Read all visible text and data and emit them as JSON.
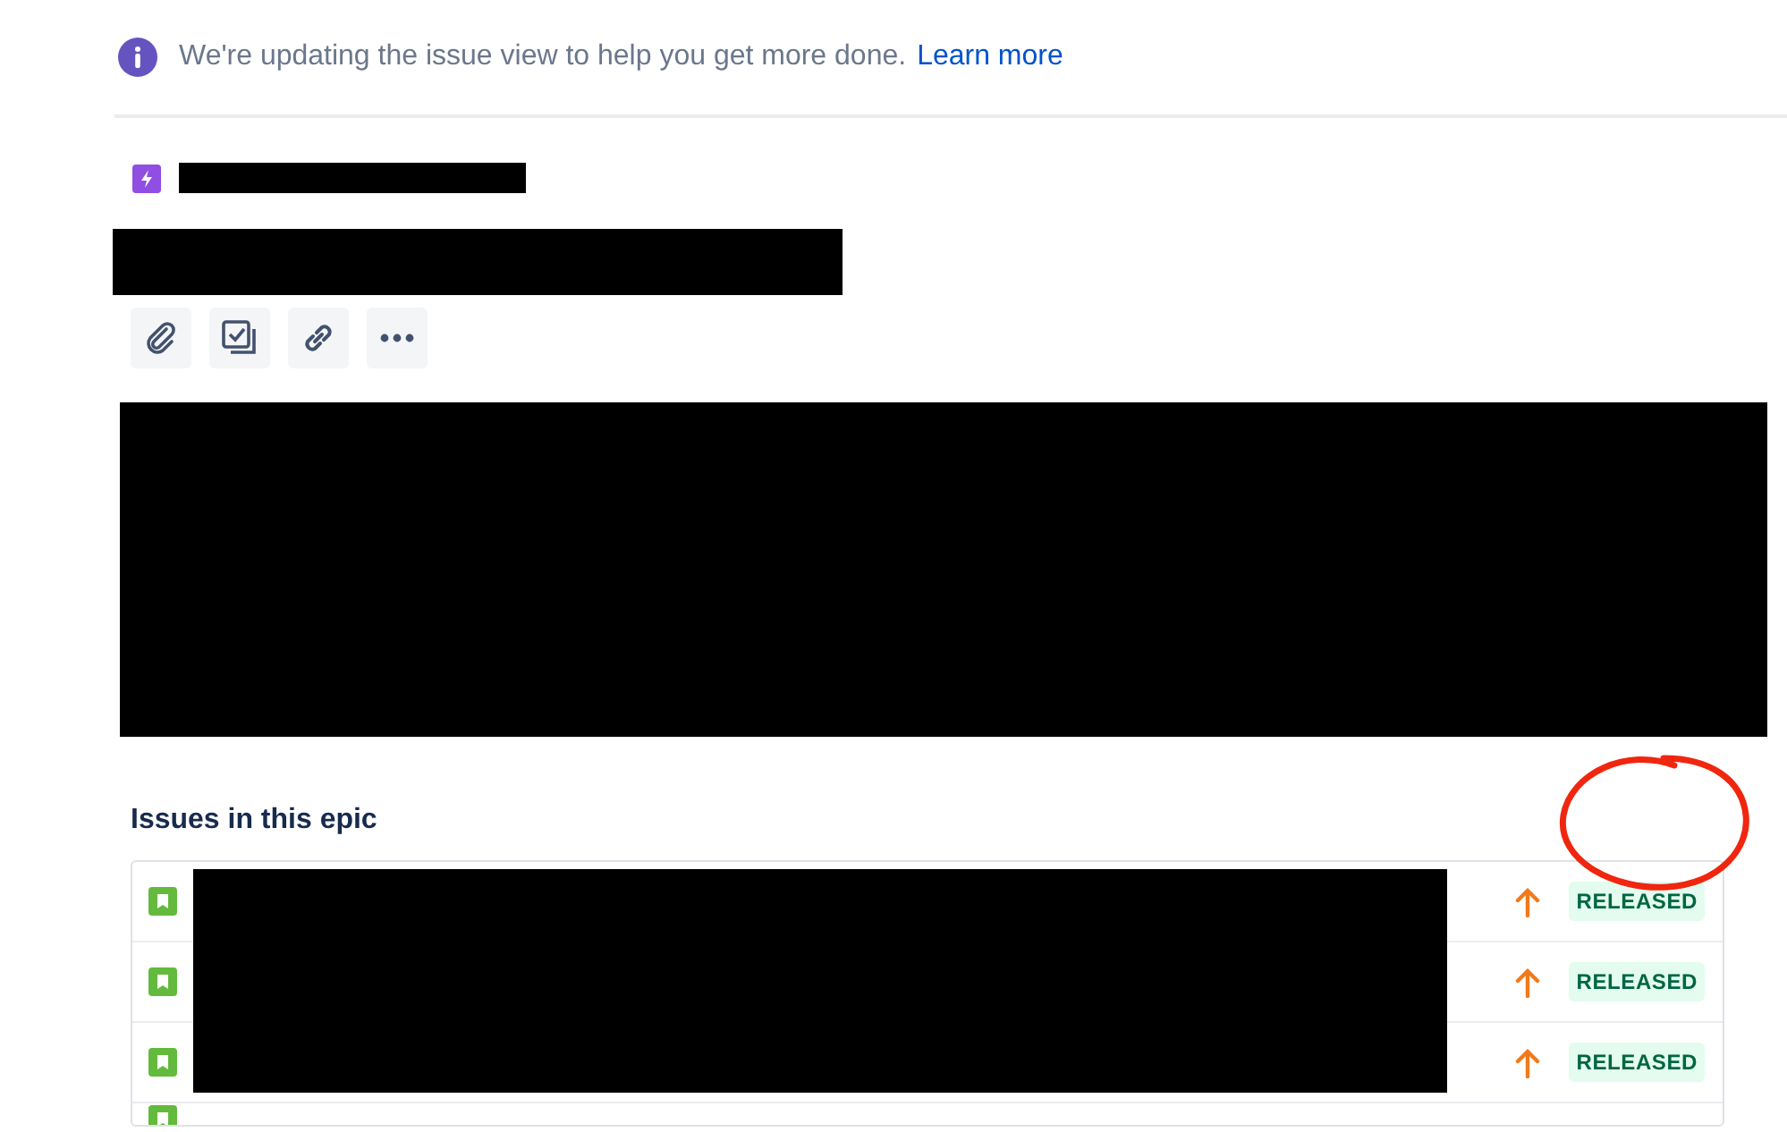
{
  "banner": {
    "message": "We're updating the issue view to help you get more done.",
    "link": "Learn more"
  },
  "section": {
    "title": "Issues in this epic"
  },
  "issues": [
    {
      "status": "RELEASED"
    },
    {
      "status": "RELEASED"
    },
    {
      "status": "RELEASED"
    }
  ]
}
